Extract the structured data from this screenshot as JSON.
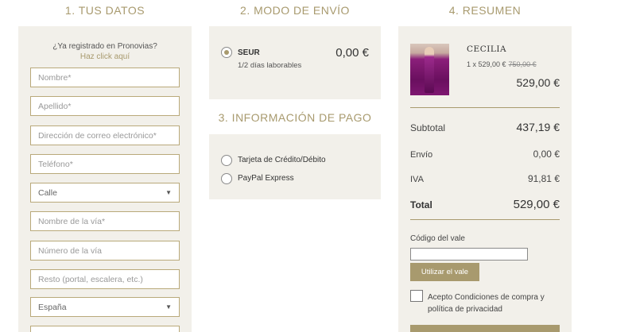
{
  "steps": {
    "step1_title": "1. TUS DATOS",
    "step2_title": "2. MODO DE ENVÍO",
    "step3_title": "3. INFORMACIÓN DE PAGO",
    "step4_title": "4. RESUMEN"
  },
  "customer": {
    "registered_question": "¿Ya registrado en Pronovias?",
    "registered_link": "Haz click aquí",
    "fields": {
      "nombre": "Nombre*",
      "apellido": "Apellido*",
      "email": "Dirección de correo electrónico*",
      "telefono": "Teléfono*",
      "calle": "Calle",
      "via_nombre": "Nombre de la vía*",
      "via_numero": "Número de la vía",
      "resto": "Resto (portal, escalera, etc.)",
      "pais": "España"
    }
  },
  "shipping": {
    "name": "SEUR",
    "days": "1/2 días laborables",
    "price": "0,00 €",
    "selected": true
  },
  "payment": {
    "options": [
      "Tarjeta de Crédito/Débito",
      "PayPal Express"
    ]
  },
  "summary": {
    "product_name": "CECILIA",
    "product_qty_price": "1 x 529,00 €",
    "product_old_price": "750,00 €",
    "product_total": "529,00 €",
    "subtotal_label": "Subtotal",
    "subtotal_value": "437,19 €",
    "envio_label": "Envío",
    "envio_value": "0,00 €",
    "iva_label": "IVA",
    "iva_value": "91,81 €",
    "total_label": "Total",
    "total_value": "529,00 €",
    "coupon_label": "Código del vale",
    "coupon_value": "",
    "coupon_button": "Utilizar el vale",
    "terms": "Acepto Condiciones de compra y política de privacidad"
  },
  "colors": {
    "accent": "#a89a6e",
    "panel": "#f2f0ea"
  }
}
